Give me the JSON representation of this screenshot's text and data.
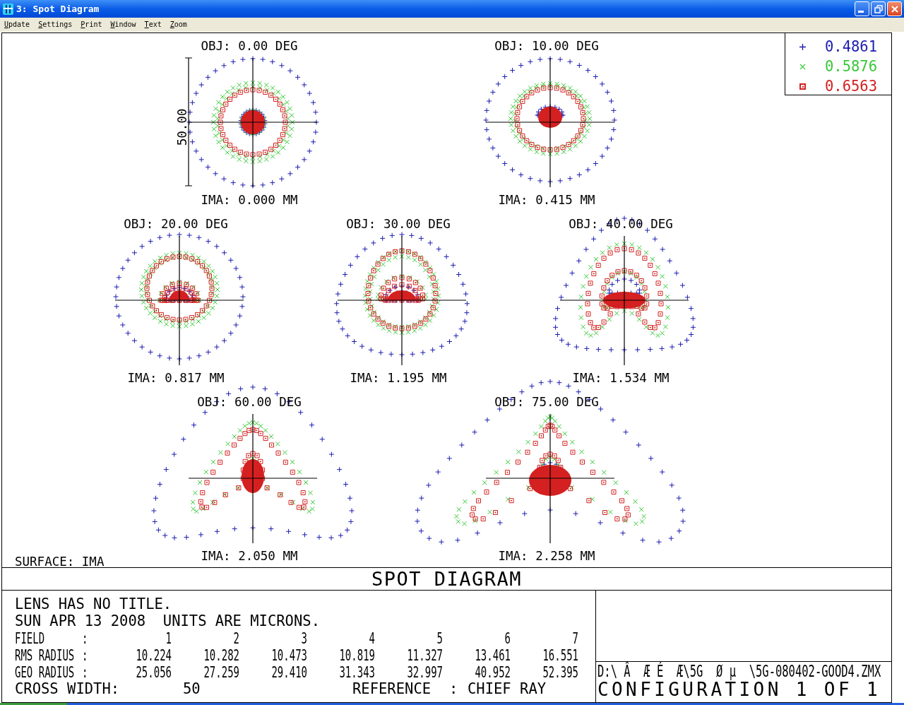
{
  "window": {
    "title": "3: Spot Diagram"
  },
  "menu": [
    "Update",
    "Settings",
    "Print",
    "Window",
    "Text",
    "Zoom"
  ],
  "plot": {
    "legend": [
      {
        "kind": "plus",
        "color": "#1c1cb0",
        "label": "0.4861"
      },
      {
        "kind": "cross",
        "color": "#38c838",
        "label": "0.5876"
      },
      {
        "kind": "square",
        "color": "#d42020",
        "label": "0.6563"
      }
    ],
    "diagrams": [
      {
        "object": "OBJ: 0.00 DEG",
        "image": "IMA: 0.000 MM",
        "scale": "50.00"
      },
      {
        "object": "OBJ: 10.00 DEG",
        "image": "IMA: 0.415 MM"
      },
      {
        "object": "OBJ: 20.00 DEG",
        "image": "IMA: 0.817 MM"
      },
      {
        "object": "OBJ: 30.00 DEG",
        "image": "IMA: 1.195 MM"
      },
      {
        "object": "OBJ: 40.00 DEG",
        "image": "IMA: 1.534 MM"
      },
      {
        "object": "OBJ: 60.00 DEG",
        "image": "IMA: 2.050 MM"
      },
      {
        "object": "OBJ: 75.00 DEG",
        "image": "IMA: 2.258 MM"
      }
    ],
    "surface": "SURFACE: IMA"
  },
  "title": "SPOT DIAGRAM",
  "summary": {
    "lines": [
      "LENS HAS NO TITLE.",
      "SUN APR 13 2008  UNITS ARE MICRONS."
    ],
    "rows": [
      {
        "label": "FIELD",
        "separator": ":",
        "values": [
          "1",
          "2",
          "3",
          "4",
          "5",
          "6",
          "7"
        ]
      },
      {
        "label": "RMS RADIUS",
        "separator": ":",
        "values": [
          "10.224",
          "10.282",
          "10.473",
          "10.819",
          "11.327",
          "13.461",
          "16.551"
        ]
      },
      {
        "label": "GEO RADIUS",
        "separator": ":",
        "values": [
          "25.056",
          "27.259",
          "29.410",
          "31.343",
          "32.997",
          "40.952",
          "52.395"
        ]
      }
    ],
    "cross_width": {
      "label": "CROSS WIDTH:",
      "value": "50"
    },
    "reference": {
      "label": "REFERENCE",
      "separator": ":",
      "value": "CHIEF RAY"
    }
  },
  "file": {
    "path": "D:\\ Â  Æ É  Æ\\5G  Ø µ  \\5G-080402-GOOD4.ZMX",
    "configuration": "CONFIGURATION 1 OF 1"
  }
}
